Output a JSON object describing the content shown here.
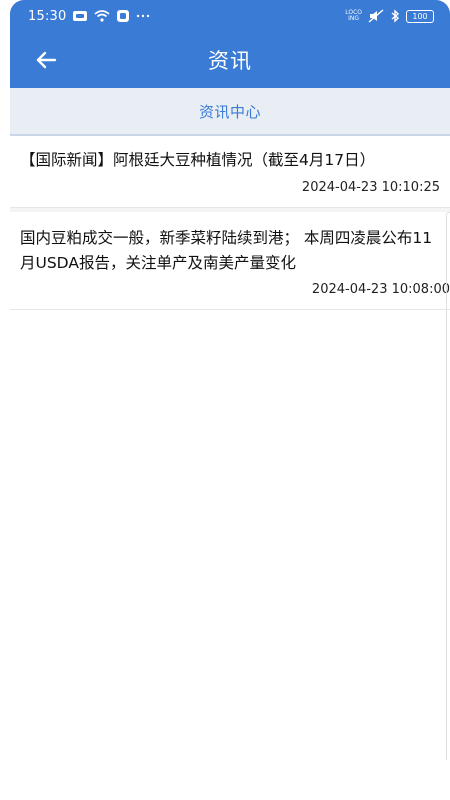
{
  "status_bar": {
    "time": "15:30",
    "network_label_top": "LOCO",
    "network_label_bottom": "ING",
    "battery": "100",
    "icons": [
      "message-icon",
      "wifi-icon",
      "app-icon",
      "more-dots-icon",
      "mute-icon",
      "bluetooth-icon",
      "battery-icon"
    ]
  },
  "app_bar": {
    "title": "资讯",
    "back_icon": "arrow-left-icon"
  },
  "section": {
    "title": "资讯中心"
  },
  "news": [
    {
      "title": "【国际新闻】阿根廷大豆种植情况（截至4月17日）",
      "time": "2024-04-23 10:10:25"
    },
    {
      "title": "国内豆粕成交一般，新季菜籽陆续到港； 本周四凌晨公布11月USDA报告，关注单产及南美产量变化",
      "time": "2024-04-23 10:08:00"
    }
  ],
  "colors": {
    "primary": "#3a7bd5",
    "section_bg": "#e9eef5",
    "text": "#111111"
  }
}
